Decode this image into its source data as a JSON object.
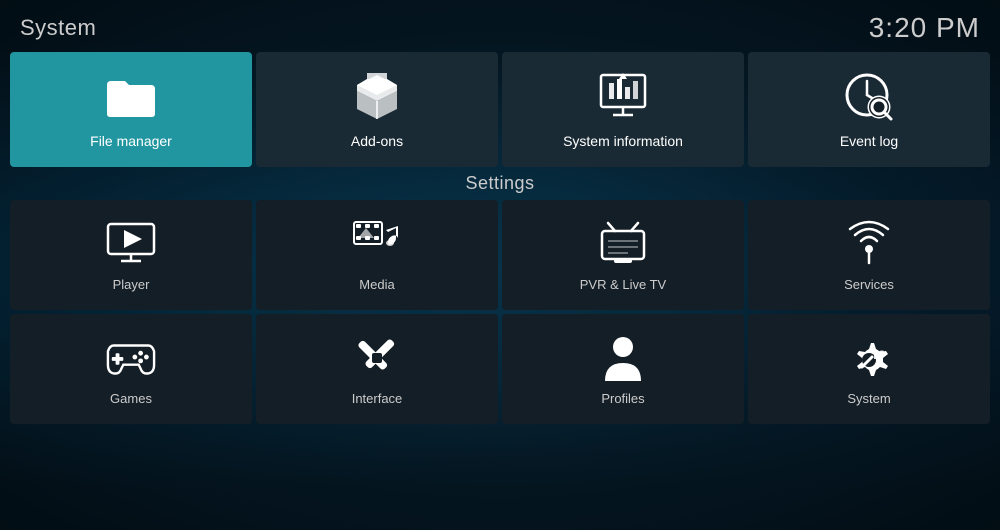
{
  "header": {
    "title": "System",
    "time": "3:20 PM"
  },
  "top_tiles": [
    {
      "id": "file-manager",
      "label": "File manager",
      "active": true
    },
    {
      "id": "add-ons",
      "label": "Add-ons",
      "active": false
    },
    {
      "id": "system-information",
      "label": "System information",
      "active": false
    },
    {
      "id": "event-log",
      "label": "Event log",
      "active": false
    }
  ],
  "settings": {
    "title": "Settings",
    "row1": [
      {
        "id": "player",
        "label": "Player"
      },
      {
        "id": "media",
        "label": "Media"
      },
      {
        "id": "pvr-live-tv",
        "label": "PVR & Live TV"
      },
      {
        "id": "services",
        "label": "Services"
      }
    ],
    "row2": [
      {
        "id": "games",
        "label": "Games"
      },
      {
        "id": "interface",
        "label": "Interface"
      },
      {
        "id": "profiles",
        "label": "Profiles"
      },
      {
        "id": "system",
        "label": "System"
      }
    ]
  }
}
